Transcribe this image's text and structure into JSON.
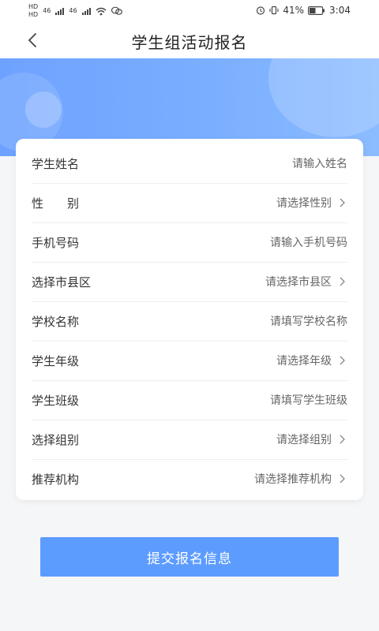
{
  "status": {
    "left_tags": [
      "HD",
      "HD",
      "46",
      "46"
    ],
    "battery": "41%",
    "time": "3:04"
  },
  "nav": {
    "title": "学生组活动报名"
  },
  "form": {
    "rows": [
      {
        "label": "学生姓名",
        "value": "请输入姓名",
        "chevron": false
      },
      {
        "label": "性　　别",
        "value": "请选择性别",
        "chevron": true
      },
      {
        "label": "手机号码",
        "value": "请输入手机号码",
        "chevron": false
      },
      {
        "label": "选择市县区",
        "value": "请选择市县区",
        "chevron": true
      },
      {
        "label": "学校名称",
        "value": "请填写学校名称",
        "chevron": false
      },
      {
        "label": "学生年级",
        "value": "请选择年级",
        "chevron": true
      },
      {
        "label": "学生班级",
        "value": "请填写学生班级",
        "chevron": false
      },
      {
        "label": "选择组别",
        "value": "请选择组别",
        "chevron": true
      },
      {
        "label": "推荐机构",
        "value": "请选择推荐机构",
        "chevron": true
      }
    ]
  },
  "actions": {
    "submit_label": "提交报名信息"
  },
  "colors": {
    "accent": "#5d9cff",
    "banner": "#7aaeff"
  }
}
